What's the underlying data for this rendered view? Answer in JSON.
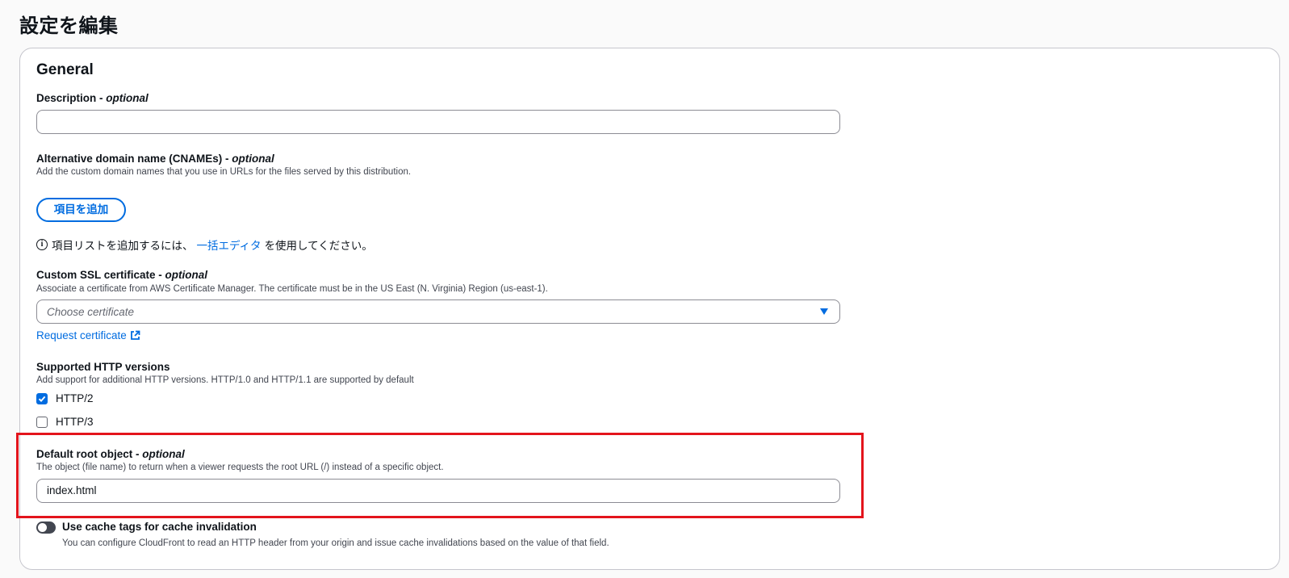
{
  "page": {
    "title": "設定を編集"
  },
  "general": {
    "title": "General",
    "description": {
      "label": "Description",
      "optional": "optional",
      "value": ""
    },
    "cnames": {
      "label": "Alternative domain name (CNAMEs)",
      "optional": "optional",
      "help": "Add the custom domain names that you use in URLs for the files served by this distribution.",
      "add_button": "項目を追加",
      "hint_before": "項目リストを追加するには、",
      "hint_link": "一括エディタ",
      "hint_after": "を使用してください。"
    },
    "ssl": {
      "label": "Custom SSL certificate",
      "optional": "optional",
      "help": "Associate a certificate from AWS Certificate Manager. The certificate must be in the US East (N. Virginia) Region (us-east-1).",
      "placeholder": "Choose certificate",
      "request_link": "Request certificate"
    },
    "http_versions": {
      "label": "Supported HTTP versions",
      "help": "Add support for additional HTTP versions. HTTP/1.0 and HTTP/1.1 are supported by default",
      "options": [
        {
          "label": "HTTP/2",
          "checked": true
        },
        {
          "label": "HTTP/3",
          "checked": false
        }
      ]
    },
    "root_object": {
      "label": "Default root object",
      "optional": "optional",
      "help": "The object (file name) to return when a viewer requests the root URL (/) instead of a specific object.",
      "value": "index.html"
    },
    "cache_tags": {
      "label": "Use cache tags for cache invalidation",
      "help": "You can configure CloudFront to read an HTTP header from your origin and issue cache invalidations based on the value of that field.",
      "enabled": false
    }
  },
  "colors": {
    "accent": "#006ce0",
    "highlight": "#e3141c",
    "toggle_off": "#424650"
  }
}
